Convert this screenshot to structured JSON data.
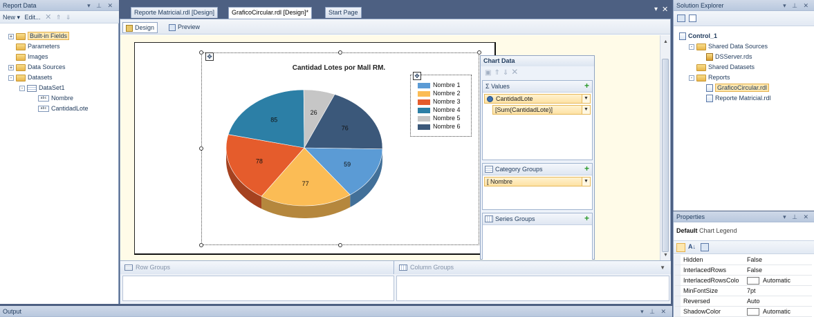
{
  "report_data": {
    "title": "Report Data",
    "toolbar": {
      "new_label": "New ▾",
      "edit_label": "Edit...",
      "delete_glyph": "✕",
      "up_glyph": "⇑",
      "down_glyph": "⇓"
    },
    "tree": [
      {
        "label": "Built-in Fields",
        "icon": "folder-icon",
        "exp": "+",
        "level": 0,
        "selected": true
      },
      {
        "label": "Parameters",
        "icon": "folder-icon",
        "exp": "",
        "level": 0
      },
      {
        "label": "Images",
        "icon": "folder-icon",
        "exp": "",
        "level": 0
      },
      {
        "label": "Data Sources",
        "icon": "folder-icon",
        "exp": "+",
        "level": 0
      },
      {
        "label": "Datasets",
        "icon": "folder-icon",
        "exp": "−",
        "level": 0
      },
      {
        "label": "DataSet1",
        "icon": "table-icon",
        "exp": "−",
        "level": 1
      },
      {
        "label": "Nombre",
        "icon": "field-icon",
        "exp": "",
        "level": 2
      },
      {
        "label": "CantidadLote",
        "icon": "field-icon",
        "exp": "",
        "level": 2
      }
    ]
  },
  "tabs": [
    {
      "label": "Reporte Matricial.rdl [Design]",
      "active": false
    },
    {
      "label": "GraficoCircular.rdl [Design]*",
      "active": true
    },
    {
      "label": "Start Page",
      "active": false
    }
  ],
  "tab_controls": {
    "dropdown_glyph": "▾",
    "close_glyph": "✕"
  },
  "view_tabs": {
    "design": "Design",
    "preview": "Preview"
  },
  "chart": {
    "title": "Cantidad Lotes por Mall RM.",
    "chart_data": {
      "type": "pie",
      "title": "Cantidad Lotes por Mall RM.",
      "categories": [
        "Nombre 1",
        "Nombre 2",
        "Nombre 3",
        "Nombre 4",
        "Nombre 5",
        "Nombre 6"
      ],
      "values": [
        59,
        77,
        78,
        85,
        26,
        76
      ],
      "colors": [
        "#5b9bd5",
        "#fbbc55",
        "#e55c2c",
        "#2c7fa6",
        "#c6c6c6",
        "#3b587a"
      ],
      "legend_position": "top-right"
    }
  },
  "chart_data_panel": {
    "title": "Chart Data",
    "values_header": "Σ Values",
    "value_item": "CantidadLote",
    "value_expr": "[Sum(CantidadLote)]",
    "category_header": "Category Groups",
    "category_item": "[ Nombre",
    "series_header": "Series Groups",
    "plus_glyph": "+"
  },
  "groups": {
    "row": "Row Groups",
    "column": "Column Groups"
  },
  "output": {
    "title": "Output"
  },
  "solution_explorer": {
    "title": "Solution Explorer",
    "tree": [
      {
        "label": "Control_1",
        "level": 0,
        "bold": true,
        "icon": "project-icon",
        "exp": ""
      },
      {
        "label": "Shared Data Sources",
        "level": 1,
        "icon": "folder-icon",
        "exp": "−"
      },
      {
        "label": "DSServer.rds",
        "level": 2,
        "icon": "datasource-icon",
        "exp": ""
      },
      {
        "label": "Shared Datasets",
        "level": 1,
        "icon": "folder-icon",
        "exp": ""
      },
      {
        "label": "Reports",
        "level": 1,
        "icon": "folder-icon",
        "exp": "−"
      },
      {
        "label": "GraficoCircular.rdl",
        "level": 2,
        "icon": "report-icon",
        "exp": "",
        "selected": true
      },
      {
        "label": "Reporte Matricial.rdl",
        "level": 2,
        "icon": "report-icon",
        "exp": ""
      }
    ]
  },
  "properties": {
    "title": "Properties",
    "object_name": "Default",
    "object_type": "Chart Legend",
    "rows": [
      {
        "key": "Hidden",
        "value": "False",
        "swatch": false
      },
      {
        "key": "InterlacedRows",
        "value": "False",
        "swatch": false
      },
      {
        "key": "InterlacedRowsColo",
        "value": "Automatic",
        "swatch": true
      },
      {
        "key": "MinFontSize",
        "value": "7pt",
        "swatch": false
      },
      {
        "key": "Reversed",
        "value": "Auto",
        "swatch": false
      },
      {
        "key": "ShadowColor",
        "value": "Automatic",
        "swatch": true
      }
    ]
  }
}
